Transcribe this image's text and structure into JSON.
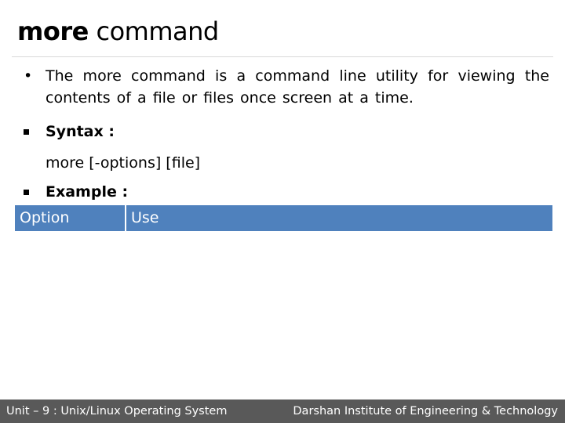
{
  "slide": {
    "title_bold": "more",
    "title_rest": " command",
    "bullets": [
      {
        "marker": "•",
        "text": "The more command is a command line utility for viewing the contents of a file or files once screen at a time."
      }
    ],
    "syntax": {
      "label": "Syntax :",
      "value": "more [-options] [file]"
    },
    "example": {
      "label": "Example :"
    },
    "table": {
      "header_color": "#4f81bd",
      "columns": [
        "Option",
        "Use"
      ],
      "rows": []
    }
  },
  "footer": {
    "left": "Unit – 9 : Unix/Linux Operating System",
    "right": "Darshan Institute of Engineering & Technology",
    "background": "#595959"
  }
}
